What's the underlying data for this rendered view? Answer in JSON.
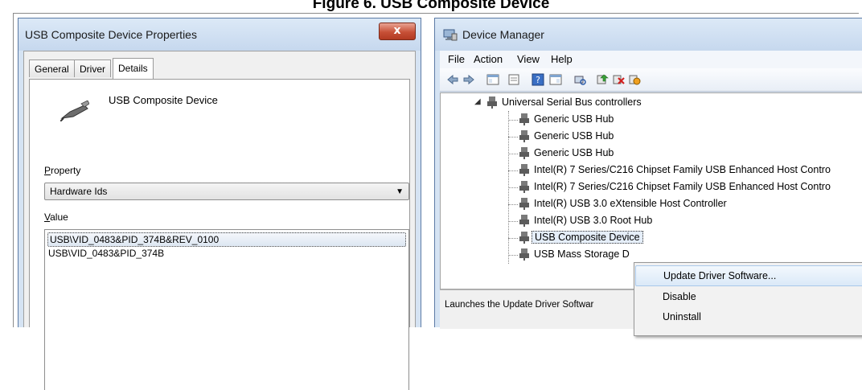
{
  "caption": "Figure 6. USB Composite Device",
  "properties_dialog": {
    "title": "USB Composite Device Properties",
    "close_label": "x",
    "tabs": [
      {
        "label": "General"
      },
      {
        "label": "Driver"
      },
      {
        "label": "Details"
      }
    ],
    "active_tab": "Details",
    "device_name": "USB Composite Device",
    "property_label_u": "P",
    "property_label_rest": "roperty",
    "property_value": "Hardware Ids",
    "value_label_u": "V",
    "value_label_rest": "alue",
    "values": [
      "USB\\VID_0483&PID_374B&REV_0100",
      "USB\\VID_0483&PID_374B"
    ]
  },
  "device_manager": {
    "title": "Device Manager",
    "menu": [
      "File",
      "Action",
      "View",
      "Help"
    ],
    "tree": {
      "parent": "Universal Serial Bus controllers",
      "children": [
        "Generic USB Hub",
        "Generic USB Hub",
        "Generic USB Hub",
        "Intel(R) 7 Series/C216 Chipset Family USB Enhanced Host Contro",
        "Intel(R) 7 Series/C216 Chipset Family USB Enhanced Host Contro",
        "Intel(R) USB 3.0 eXtensible Host Controller",
        "Intel(R) USB 3.0 Root Hub",
        "USB Composite Device",
        "USB Mass Storage D"
      ]
    },
    "status_text": "Launches the Update Driver Softwar",
    "context_menu": [
      "Update Driver Software...",
      "Disable",
      "Uninstall"
    ]
  },
  "colors": {
    "titlebar": "#c6d8ee",
    "close_button": "#c75037",
    "highlight": "#dbe9f8"
  }
}
